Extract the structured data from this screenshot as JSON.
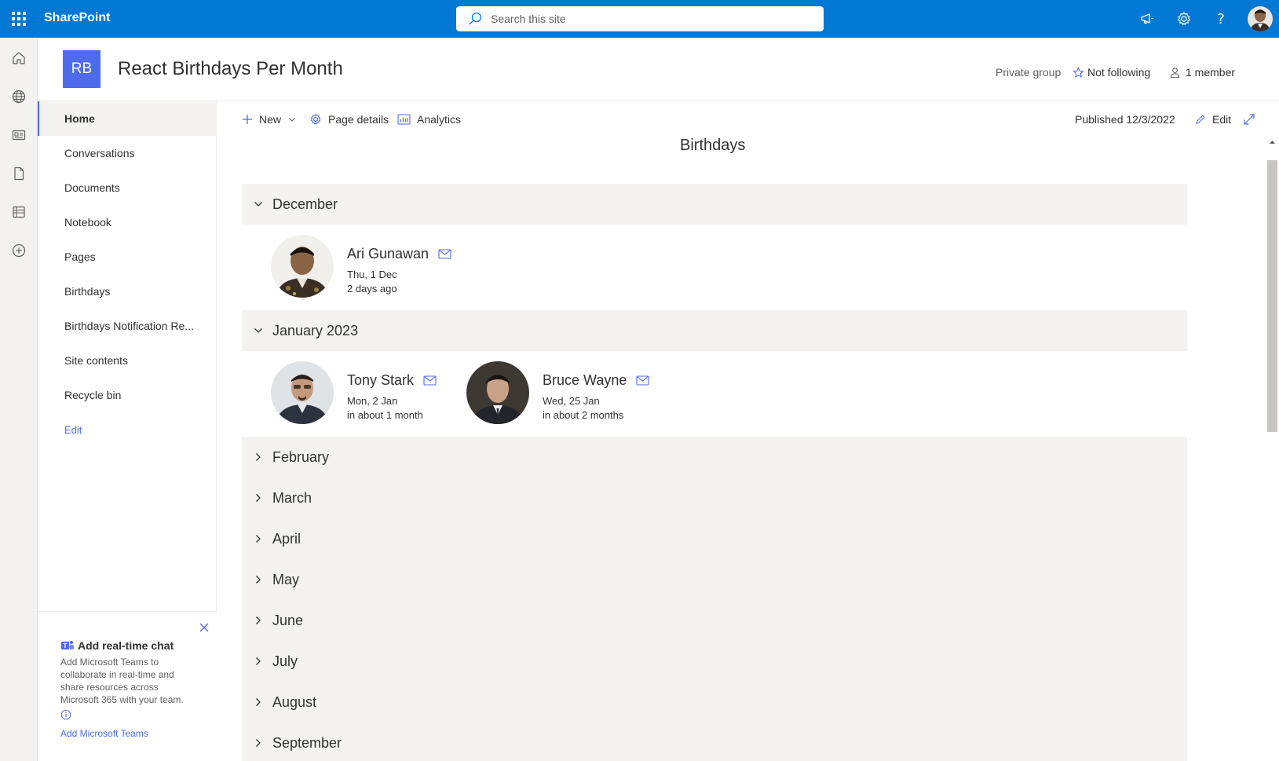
{
  "suitebar": {
    "brand": "SharePoint",
    "search_placeholder": "Search this site"
  },
  "site": {
    "logo_initials": "RB",
    "title": "React Birthdays Per Month",
    "privacy": "Private group",
    "follow": "Not following",
    "members": "1 member"
  },
  "nav": {
    "items": [
      {
        "label": "Home"
      },
      {
        "label": "Conversations"
      },
      {
        "label": "Documents"
      },
      {
        "label": "Notebook"
      },
      {
        "label": "Pages"
      },
      {
        "label": "Birthdays"
      },
      {
        "label": "Birthdays Notification Re..."
      },
      {
        "label": "Site contents"
      },
      {
        "label": "Recycle bin"
      }
    ],
    "edit": "Edit"
  },
  "teams_card": {
    "title": "Add real-time chat",
    "description": "Add Microsoft Teams to collaborate in real-time and share resources across Microsoft 365 with your team.",
    "link": "Add Microsoft Teams"
  },
  "commandbar": {
    "new": "New",
    "page_details": "Page details",
    "analytics": "Analytics",
    "published": "Published 12/3/2022",
    "edit": "Edit"
  },
  "birthdays": {
    "title": "Birthdays",
    "groups": [
      {
        "month": "December",
        "expanded": true,
        "people": [
          {
            "name": "Ari Gunawan",
            "date": "Thu, 1 Dec",
            "relative": "2 days ago"
          }
        ]
      },
      {
        "month": "January 2023",
        "expanded": true,
        "people": [
          {
            "name": "Tony Stark",
            "date": "Mon, 2 Jan",
            "relative": "in about 1 month"
          },
          {
            "name": "Bruce Wayne",
            "date": "Wed, 25 Jan",
            "relative": "in about 2 months"
          }
        ]
      },
      {
        "month": "February",
        "expanded": false
      },
      {
        "month": "March",
        "expanded": false
      },
      {
        "month": "April",
        "expanded": false
      },
      {
        "month": "May",
        "expanded": false
      },
      {
        "month": "June",
        "expanded": false
      },
      {
        "month": "July",
        "expanded": false
      },
      {
        "month": "August",
        "expanded": false
      },
      {
        "month": "September",
        "expanded": false
      }
    ]
  },
  "colors": {
    "suite_blue": "#0078d4",
    "accent": "#4f6bed",
    "group_bg": "#f3f2f1"
  }
}
